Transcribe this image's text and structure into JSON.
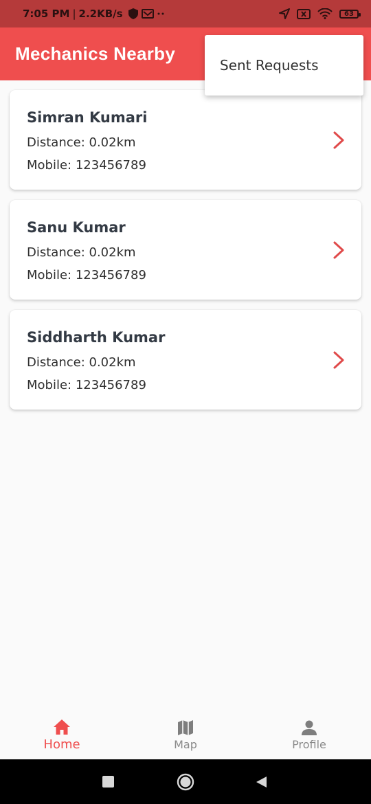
{
  "status_bar": {
    "time": "7:05 PM",
    "separator": "|",
    "speed": "2.2KB/s",
    "icons_left": [
      "shield-icon",
      "mail-icon",
      "more-dots-icon"
    ],
    "icons_right": [
      "location-icon",
      "sim-off-icon",
      "wifi-icon",
      "battery-icon"
    ],
    "battery": "63"
  },
  "app_bar": {
    "title": "Mechanics Nearby"
  },
  "popup_menu": {
    "items": [
      {
        "label": "Sent Requests"
      }
    ]
  },
  "mechanics": [
    {
      "name": "Simran Kumari",
      "distance": "Distance: 0.02km",
      "mobile": "Mobile: 123456789"
    },
    {
      "name": "Sanu Kumar",
      "distance": "Distance: 0.02km",
      "mobile": "Mobile: 123456789"
    },
    {
      "name": "Siddharth Kumar",
      "distance": "Distance: 0.02km",
      "mobile": "Mobile: 123456789"
    }
  ],
  "bottom_nav": {
    "items": [
      {
        "label": "Home",
        "icon": "home-icon",
        "active": true
      },
      {
        "label": "Map",
        "icon": "map-icon",
        "active": false
      },
      {
        "label": "Profile",
        "icon": "person-icon",
        "active": false
      }
    ]
  },
  "colors": {
    "accent": "#ef4e4e",
    "status_bar": "#b53a3a",
    "inactive": "#8a8a8a"
  }
}
